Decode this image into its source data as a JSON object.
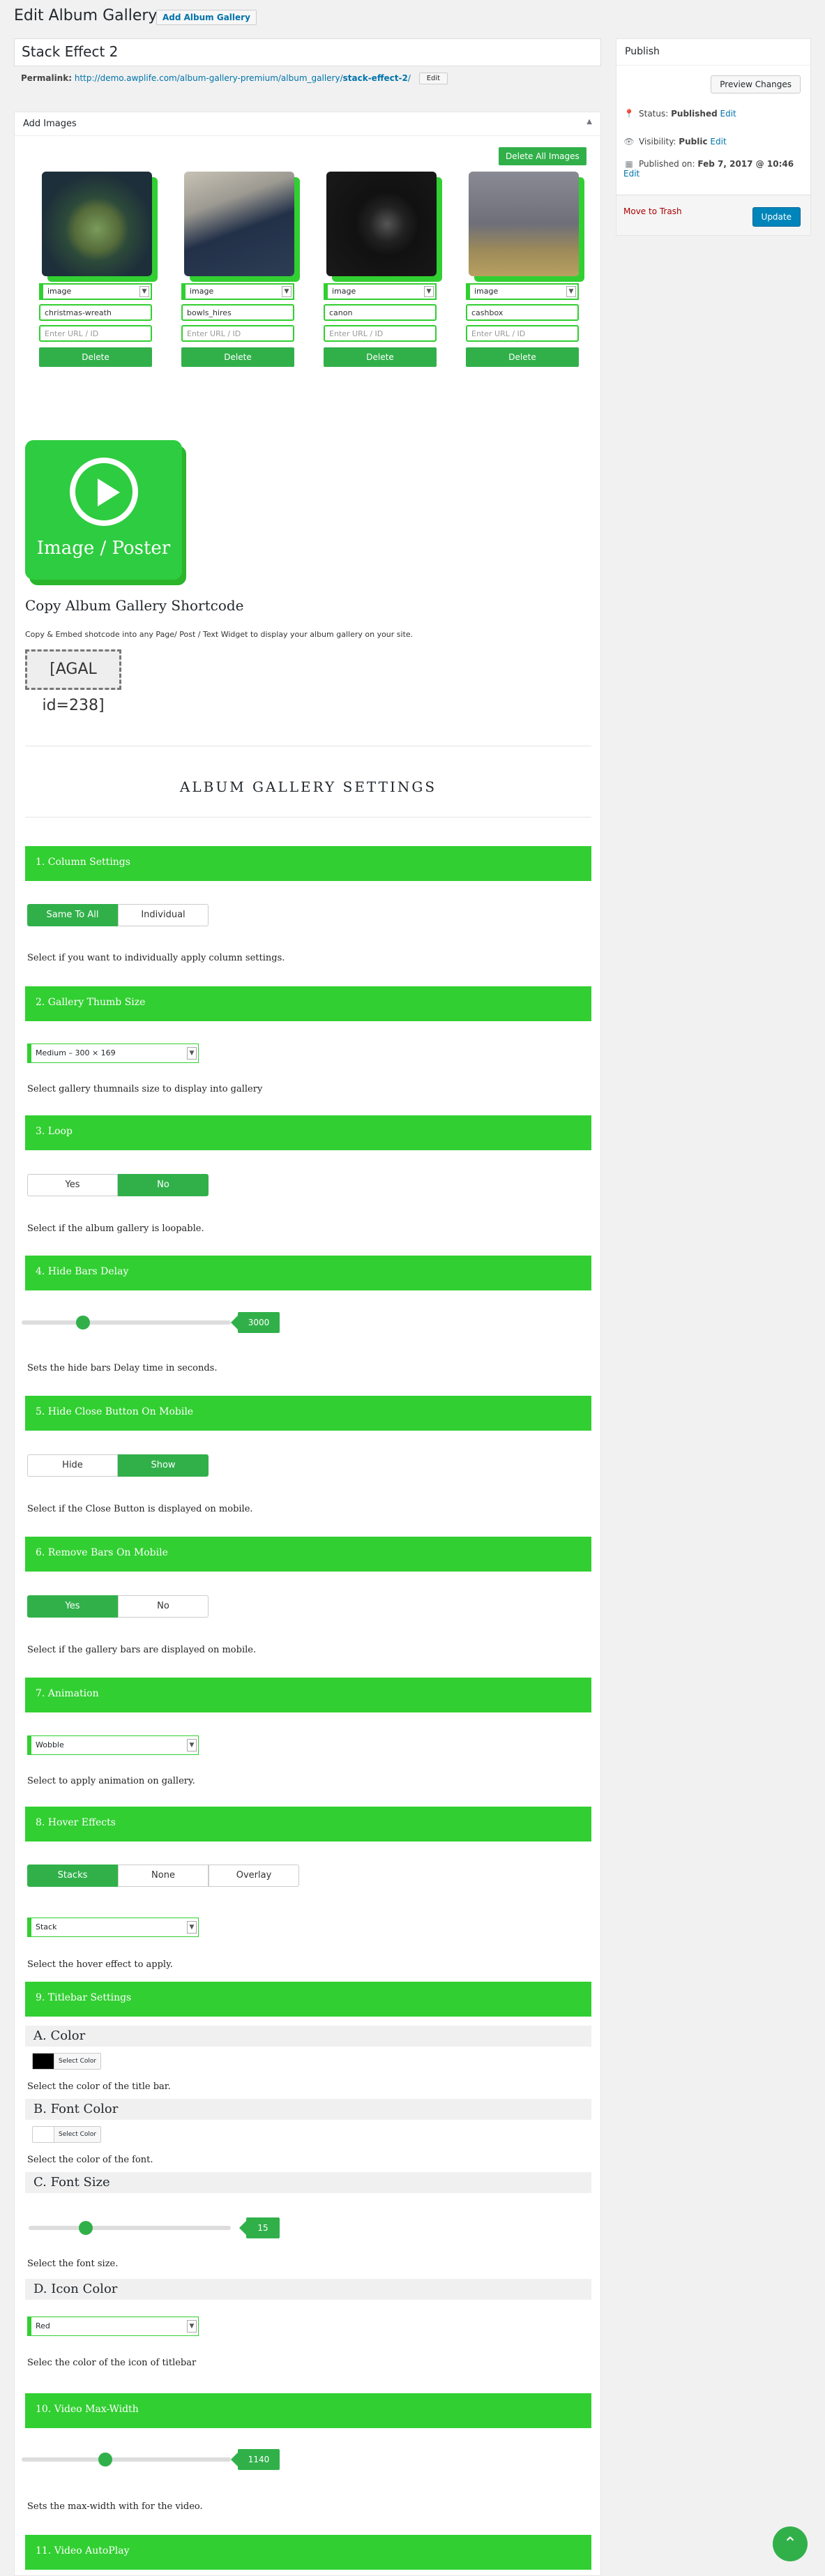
{
  "header": {
    "title": "Edit Album Gallery",
    "add_new": "Add Album Gallery"
  },
  "post": {
    "title": "Stack Effect 2",
    "permalink_label": "Permalink:",
    "permalink_base": "http://demo.awplife.com/album-gallery-premium/album_gallery/",
    "permalink_slug": "stack-effect-2",
    "permalink_tail": "/",
    "edit_label": "Edit"
  },
  "publish": {
    "title": "Publish",
    "preview": "Preview Changes",
    "status_label": "Status:",
    "status_value": "Published",
    "status_edit": "Edit",
    "visibility_label": "Visibility:",
    "visibility_value": "Public",
    "visibility_edit": "Edit",
    "published_label": "Published on:",
    "published_value": "Feb 7, 2017 @ 10:46",
    "published_edit": "Edit",
    "trash": "Move to Trash",
    "update": "Update"
  },
  "images": {
    "title": "Add Images",
    "delete_all": "Delete All Images",
    "items": [
      {
        "type": "image",
        "name": "christmas-wreath",
        "url_placeholder": "Enter URL / ID",
        "delete": "Delete",
        "bg": "#2d4a3a"
      },
      {
        "type": "image",
        "name": "bowls_hires",
        "url_placeholder": "Enter URL / ID",
        "delete": "Delete",
        "bg": "#2c3e55"
      },
      {
        "type": "image",
        "name": "canon",
        "url_placeholder": "Enter URL / ID",
        "delete": "Delete",
        "bg": "#1a1a1a"
      },
      {
        "type": "image",
        "name": "cashbox",
        "url_placeholder": "Enter URL / ID",
        "delete": "Delete",
        "bg": "#6f6f7a"
      }
    ]
  },
  "poster": {
    "label": "Image / Poster"
  },
  "shortcode": {
    "title": "Copy Album Gallery Shortcode",
    "desc": "Copy & Embed shotcode into any Page/ Post / Text Widget to display your album gallery on your site.",
    "code": "[AGAL id=238]"
  },
  "settings": {
    "title": "ALBUM   GALLERY   SETTINGS",
    "s1": {
      "title": "1. Column Settings",
      "opt1": "Same To All",
      "opt2": "Individual",
      "desc": "Select if you want to individually apply column settings."
    },
    "s2": {
      "title": "2. Gallery Thumb Size",
      "value": "Medium – 300 × 169",
      "desc": "Select gallery thumnails size to display into gallery"
    },
    "s3": {
      "title": "3. Loop",
      "opt1": "Yes",
      "opt2": "No",
      "desc": "Select if the album gallery is loopable."
    },
    "s4": {
      "title": "4. Hide Bars Delay",
      "value": "3000",
      "desc": "Sets the hide bars Delay time in seconds."
    },
    "s5": {
      "title": "5. Hide Close Button On Mobile",
      "opt1": "Hide",
      "opt2": "Show",
      "desc": "Select if the Close Button is displayed on mobile."
    },
    "s6": {
      "title": "6. Remove Bars On Mobile",
      "opt1": "Yes",
      "opt2": "No",
      "desc": "Select if the gallery bars are displayed on mobile."
    },
    "s7": {
      "title": "7. Animation",
      "value": "Wobble",
      "desc": "Select to apply animation on gallery."
    },
    "s8": {
      "title": "8. Hover Effects",
      "opt1": "Stacks",
      "opt2": "None",
      "opt3": "Overlay",
      "value": "Stack",
      "desc": "Select the hover effect to apply."
    },
    "s9": {
      "title": "9. Titlebar Settings",
      "a": {
        "title": "A. Color",
        "btn": "Select Color",
        "swatch": "#000000",
        "desc": "Select the color of the title bar."
      },
      "b": {
        "title": "B. Font Color",
        "btn": "Select Color",
        "swatch": "#ffffff",
        "desc": "Select the color of the font."
      },
      "c": {
        "title": "C. Font Size",
        "value": "15",
        "desc": "Select the font size."
      },
      "d": {
        "title": "D. Icon Color",
        "value": "Red",
        "desc": "Selec the color of the icon of titlebar"
      }
    },
    "s10": {
      "title": "10. Video Max-Width",
      "value": "1140",
      "desc": "Sets the max-width with for the video."
    },
    "s11": {
      "title": "11. Video AutoPlay"
    }
  },
  "colors": {
    "accent": "#31cf31",
    "button": "#31b04a",
    "wp_blue": "#0085ba"
  }
}
